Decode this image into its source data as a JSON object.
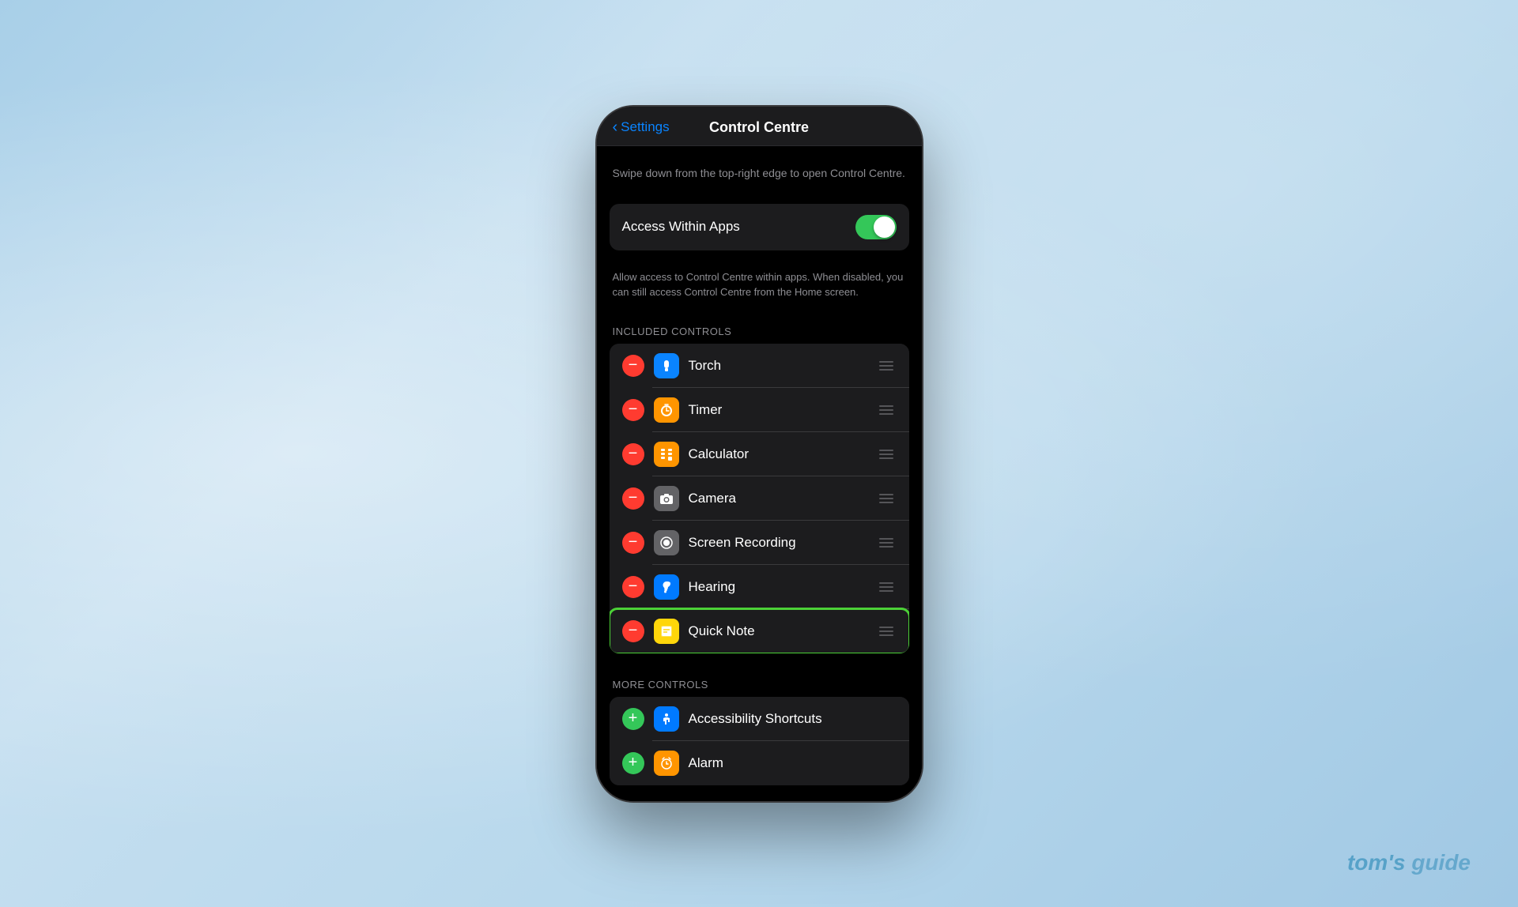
{
  "nav": {
    "back_label": "Settings",
    "title": "Control Centre"
  },
  "description": "Swipe down from the top-right edge to open Control Centre.",
  "toggle_section": {
    "label": "Access Within Apps",
    "description": "Allow access to Control Centre within apps. When disabled, you can still access Control Centre from the Home screen.",
    "enabled": true
  },
  "included_controls": {
    "header": "INCLUDED CONTROLS",
    "items": [
      {
        "id": "torch",
        "name": "Torch",
        "icon_type": "blue",
        "icon_symbol": "🔦"
      },
      {
        "id": "timer",
        "name": "Timer",
        "icon_type": "orange",
        "icon_symbol": "⏱"
      },
      {
        "id": "calculator",
        "name": "Calculator",
        "icon_type": "orange2",
        "icon_symbol": "🧮"
      },
      {
        "id": "camera",
        "name": "Camera",
        "icon_type": "gray",
        "icon_symbol": "📷"
      },
      {
        "id": "screen-recording",
        "name": "Screen Recording",
        "icon_type": "red",
        "icon_symbol": "⏺"
      },
      {
        "id": "hearing",
        "name": "Hearing",
        "icon_type": "blue2",
        "icon_symbol": "👂"
      },
      {
        "id": "quick-note",
        "name": "Quick Note",
        "icon_type": "yellow",
        "icon_symbol": "📝",
        "highlighted": true
      }
    ]
  },
  "more_controls": {
    "header": "MORE CONTROLS",
    "items": [
      {
        "id": "accessibility-shortcuts",
        "name": "Accessibility Shortcuts",
        "icon_type": "blue2",
        "icon_symbol": "♿"
      },
      {
        "id": "alarm",
        "name": "Alarm",
        "icon_type": "orange",
        "icon_symbol": "⏰"
      }
    ]
  },
  "watermark": "tom's guide"
}
